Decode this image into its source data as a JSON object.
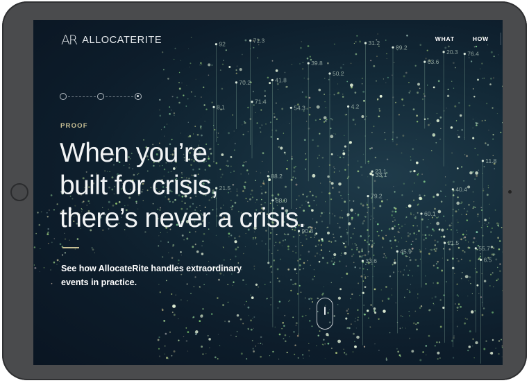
{
  "brand": {
    "mark": "AR",
    "name": "ALLOCATERITE"
  },
  "nav": {
    "items": [
      "WHAT",
      "HOW"
    ]
  },
  "progress": {
    "total_steps": 3,
    "active_step": 3
  },
  "hero": {
    "eyebrow": "PROOF",
    "headline_lines": [
      "When you’re",
      "built for crisis,",
      "there’s never a crisis."
    ],
    "subtext": "See how AllocateRite handles extraordinary events in practice."
  },
  "background_labels": [
    "60.1",
    "50.2",
    "33.6",
    "31.2",
    "6.5",
    "40.4",
    "71.4",
    "71.3",
    "4.2",
    "21.5",
    "8.1",
    "21.5",
    "92",
    "11.8",
    "55.7",
    "63.6",
    "23.1",
    "20.3",
    "88.2",
    "70.2",
    "76.4",
    "89.2",
    "88.0",
    "41.8",
    "79.2",
    "45.9",
    "90.8",
    "54.3",
    "33.1",
    "39.8"
  ],
  "colors": {
    "accent": "#c9c196",
    "screen_bg": "#0d1d2b",
    "bezel": "#4a4b4d"
  }
}
